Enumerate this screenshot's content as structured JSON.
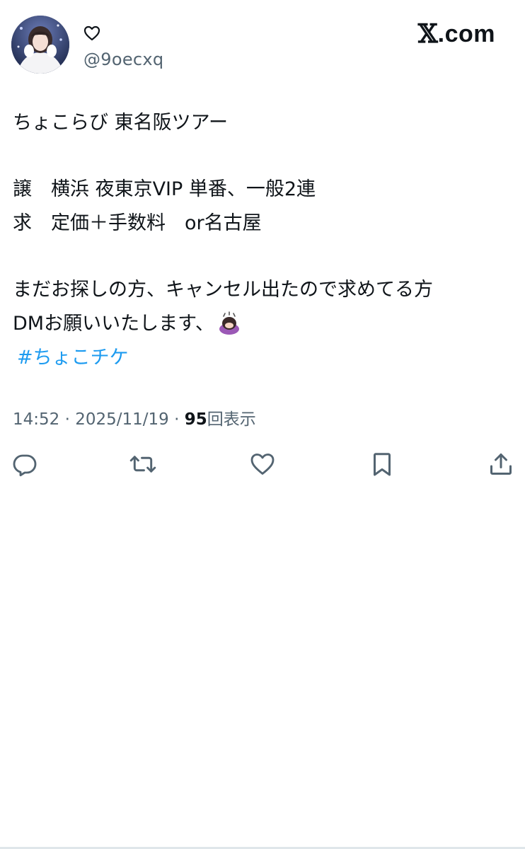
{
  "header": {
    "display_name_icon": "heart-outline-icon",
    "handle": "@9oecxq",
    "brand_logo": "𝕏",
    "brand_suffix": ".com"
  },
  "tweet": {
    "lines": [
      "ちょこらび 東名阪ツアー",
      "",
      "譲　横浜 夜東京VIP 単番、一般2連",
      "求　定価＋手数料　or名古屋",
      "",
      "まだお探しの方、キャンセル出たので求めてる方",
      "DMお願いいたします、"
    ],
    "emoji": "🙇‍♀️",
    "hashtag": "#ちょこチケ"
  },
  "meta": {
    "time": "14:52",
    "separator": " · ",
    "date": "2025/11/19",
    "views_count": "95",
    "views_label": "回表示"
  },
  "actions": {
    "icons": [
      "reply-icon",
      "retweet-icon",
      "like-icon",
      "bookmark-icon",
      "share-icon"
    ]
  },
  "colors": {
    "text": "#0f1419",
    "secondary": "#536471",
    "link": "#1d9bf0",
    "background": "#ffffff"
  }
}
